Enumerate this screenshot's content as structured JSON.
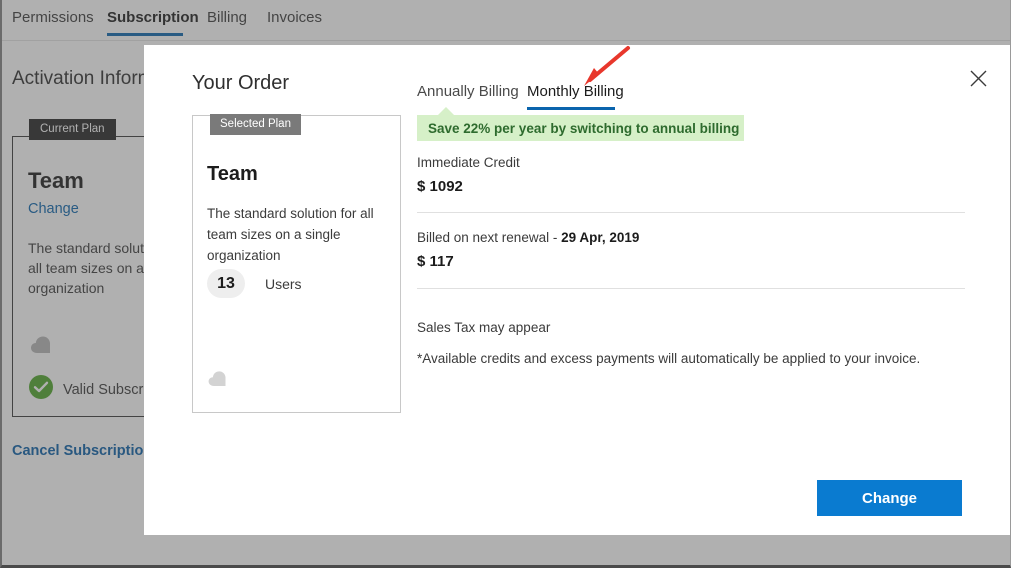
{
  "background": {
    "tabs": [
      {
        "label": "Permissions",
        "active": false
      },
      {
        "label": "Subscription",
        "active": true
      },
      {
        "label": "Billing",
        "active": false
      },
      {
        "label": "Invoices",
        "active": false
      }
    ],
    "heading": "Activation Information",
    "plan_card": {
      "badge": "Current Plan",
      "title": "Team",
      "change_link": "Change",
      "description": "The standard solution for all team sizes on a single organization",
      "status": "Valid Subscription"
    },
    "cancel_link": "Cancel Subscription"
  },
  "modal": {
    "close_icon": "close-icon",
    "order_title": "Your Order",
    "selected_plan": {
      "badge": "Selected Plan",
      "title": "Team",
      "description": "The standard solution for all team sizes on a single organization",
      "users_count": "13",
      "users_label": "Users"
    },
    "billing_tabs": [
      {
        "label": "Annually Billing",
        "active": false
      },
      {
        "label": "Monthly Billing",
        "active": true
      }
    ],
    "save_banner": "Save 22% per year by switching to annual billing",
    "lines": [
      {
        "label": "Immediate Credit",
        "amount": "$ 1092"
      },
      {
        "label_prefix": "Billed on next renewal - ",
        "label_bold": "29 Apr, 2019",
        "amount": "$ 117"
      }
    ],
    "sales_tax_note": "Sales Tax may appear",
    "footnote": "*Available credits and excess payments will automatically be applied to your invoice.",
    "primary_button": "Change"
  },
  "annotation": {
    "arrow_color": "#e8372c"
  },
  "colors": {
    "accent_blue": "#0a7bd0",
    "tab_underline": "#0a64ad",
    "banner_green_bg": "#d6f0c8",
    "banner_green_text": "#2e6b2e",
    "badge_dark": "#262626",
    "badge_gray": "#7a7a7a"
  }
}
